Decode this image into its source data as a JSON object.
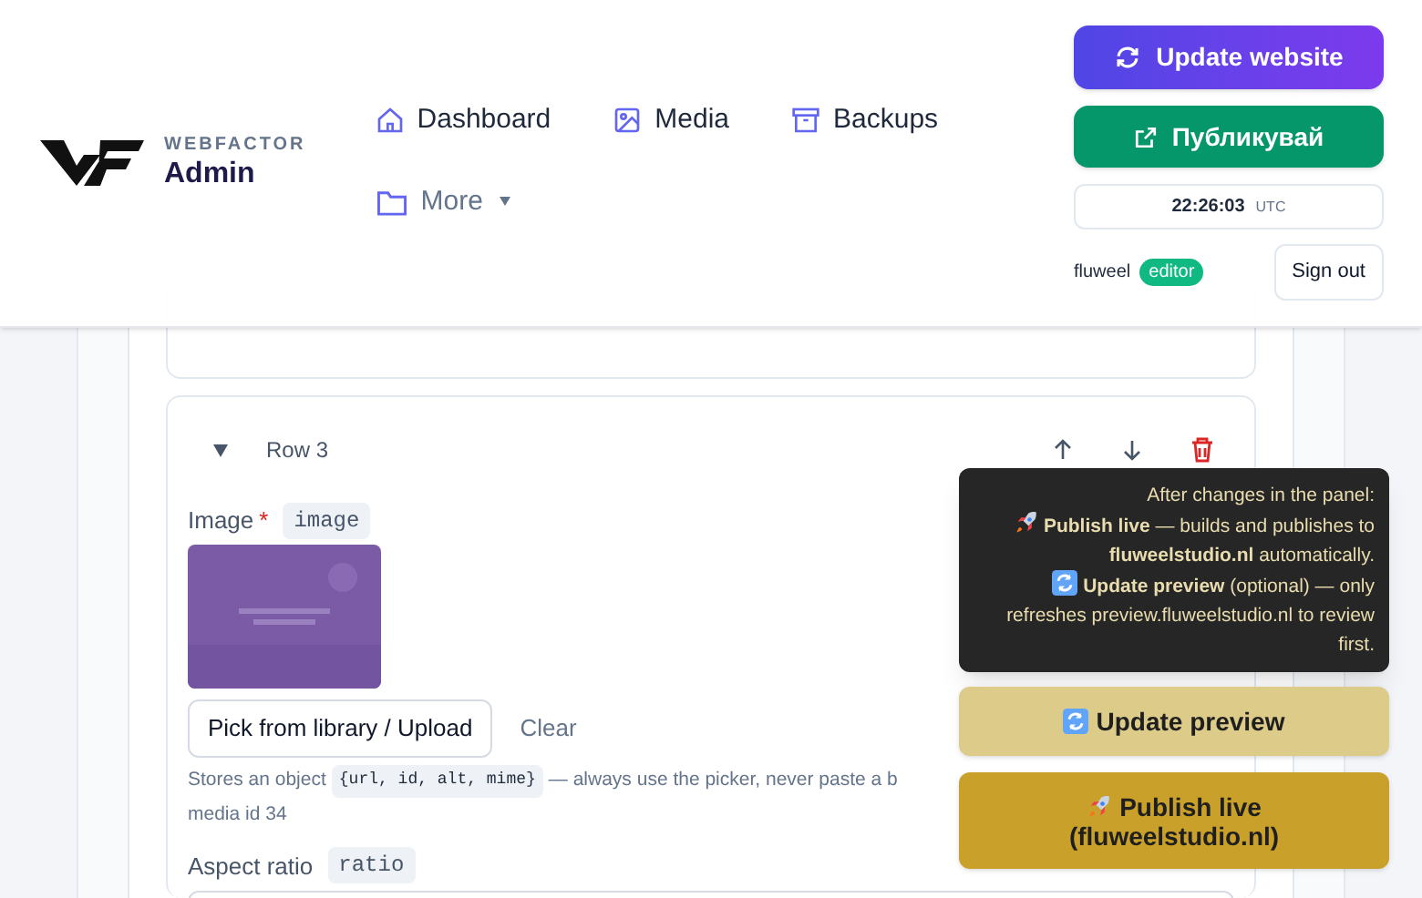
{
  "brand": {
    "top": "WEBFACTOR",
    "title": "Admin"
  },
  "nav": [
    {
      "label": "Dashboard",
      "dropdown": false
    },
    {
      "label": "Media",
      "dropdown": false
    },
    {
      "label": "Backups",
      "dropdown": false
    },
    {
      "label": "More",
      "dropdown": true
    }
  ],
  "actions": {
    "update": "Update website",
    "publish": "Публикувай",
    "time": "22:26:03",
    "zone": "UTC",
    "user": "fluweel",
    "role": "editor",
    "signout": "Sign out"
  },
  "row": {
    "title": "Row 3",
    "expanded": true,
    "image_field": {
      "label": "Image",
      "required": true,
      "required_mark": "*",
      "key": "image",
      "pick": "Pick from library / Upload",
      "clear": "Clear",
      "help": "Stores an object",
      "code": "{url, id, alt, mime}",
      "help_tail": "— always use the picker, never paste a b",
      "media": "media id 34"
    },
    "ratio_field": {
      "label": "Aspect ratio",
      "key": "ratio"
    }
  },
  "panel": {
    "note": [
      "After changes in the panel:",
      "**Publish live** — builds and publishes to **fluweelstudio.nl** automatically.",
      "**Update preview** (optional) — only refreshes preview.fluweelstudio.nl to review first."
    ],
    "preview": "Update preview",
    "publish": [
      "Publish live",
      "(fluweelstudio.nl)"
    ]
  }
}
